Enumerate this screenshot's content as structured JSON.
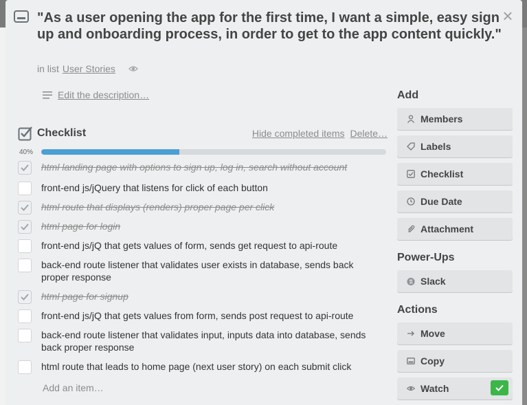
{
  "card": {
    "title": "\"As a user opening the app for the first time, I want a simple, easy sign up and onboarding process, in order to get to the app content quickly.\"",
    "in_list_prefix": "in list",
    "list_name": "User Stories",
    "edit_description": "Edit the description…"
  },
  "checklist": {
    "title": "Checklist",
    "hide_completed": "Hide completed items",
    "delete": "Delete…",
    "progress_label": "40%",
    "progress_percent": 40,
    "add_item": "Add an item…",
    "items": [
      {
        "text": "html landing page with options to sign up, log in, search without account",
        "done": true
      },
      {
        "text": "front-end js/jQuery that listens for click of each button",
        "done": false
      },
      {
        "text": "html route that displays (renders) proper page per click",
        "done": true
      },
      {
        "text": "html page for login",
        "done": true
      },
      {
        "text": "front-end js/jQ that gets values of form, sends get request to api-route",
        "done": false
      },
      {
        "text": "back-end route listener that validates user exists in database, sends back proper response",
        "done": false
      },
      {
        "text": "html page for signup",
        "done": true
      },
      {
        "text": "front-end js/jQ that gets values from form, sends post request to api-route",
        "done": false
      },
      {
        "text": "back-end route listener that validates input, inputs data into database, sends back proper response",
        "done": false
      },
      {
        "text": "html route that leads to home page (next user story) on each submit click",
        "done": false
      }
    ]
  },
  "sidebar": {
    "add_title": "Add",
    "add_buttons": [
      {
        "label": "Members",
        "icon": "person-icon"
      },
      {
        "label": "Labels",
        "icon": "tag-icon"
      },
      {
        "label": "Checklist",
        "icon": "checkbox-icon"
      },
      {
        "label": "Due Date",
        "icon": "clock-icon"
      },
      {
        "label": "Attachment",
        "icon": "paperclip-icon"
      }
    ],
    "powerups_title": "Power-Ups",
    "powerups_buttons": [
      {
        "label": "Slack",
        "icon": "slack-icon"
      }
    ],
    "actions_title": "Actions",
    "actions_buttons": [
      {
        "label": "Move",
        "icon": "arrow-right-icon"
      },
      {
        "label": "Copy",
        "icon": "copy-icon"
      },
      {
        "label": "Watch",
        "icon": "eye-icon"
      }
    ]
  },
  "colors": {
    "progress": "#4a9fd6",
    "watch_active": "#3cb649",
    "modal_bg": "#edeff0"
  }
}
